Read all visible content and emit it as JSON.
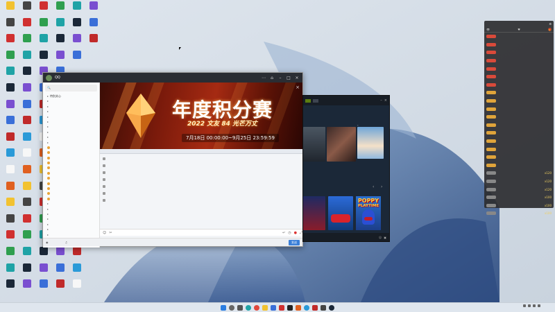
{
  "qq": {
    "title": "QQ",
    "banner": {
      "title": "年度积分赛",
      "subtitle": "2022 文友 84 光芒万丈",
      "dates": "7月18日 00:00:00~9月25日 23:59:59"
    },
    "input_placeholder": "",
    "send_label": "发送",
    "bottom_items": [
      "",
      "",
      "",
      "",
      "",
      "",
      ""
    ],
    "contacts": [
      {
        "label": "特别关心",
        "group": true
      },
      {
        "label": "",
        "group": true
      },
      {
        "label": "",
        "group": true
      },
      {
        "label": "",
        "group": true
      },
      {
        "label": "",
        "group": true
      },
      {
        "label": "",
        "group": true
      },
      {
        "label": "",
        "group": true
      },
      {
        "label": "",
        "group": true
      },
      {
        "label": "",
        "group": true
      },
      {
        "label": "",
        "group": true
      },
      {
        "label": "",
        "group": false
      },
      {
        "label": "",
        "group": false
      },
      {
        "label": "",
        "group": false
      },
      {
        "label": "",
        "group": false
      },
      {
        "label": "",
        "group": false
      },
      {
        "label": "",
        "group": false
      },
      {
        "label": "",
        "group": false
      },
      {
        "label": "",
        "group": false
      },
      {
        "label": "",
        "group": false
      },
      {
        "label": "",
        "group": false
      },
      {
        "label": "",
        "group": false
      },
      {
        "label": "",
        "group": true
      },
      {
        "label": "",
        "group": true
      },
      {
        "label": "",
        "group": true
      },
      {
        "label": "",
        "group": true
      },
      {
        "label": "",
        "group": true
      },
      {
        "label": "",
        "group": true
      },
      {
        "label": "",
        "group": true
      }
    ],
    "messages": [
      "",
      "",
      "",
      "",
      "",
      "",
      ""
    ]
  },
  "steam": {
    "poppy_line1": "POPPY",
    "poppy_line2": "PLAYTIME"
  },
  "chat": {
    "title": "",
    "rows": [
      {
        "badge": "red",
        "amount": ""
      },
      {
        "badge": "red",
        "amount": ""
      },
      {
        "badge": "red",
        "amount": ""
      },
      {
        "badge": "red",
        "amount": ""
      },
      {
        "badge": "red",
        "amount": ""
      },
      {
        "badge": "red",
        "amount": ""
      },
      {
        "badge": "red",
        "amount": ""
      },
      {
        "badge": "gold",
        "amount": ""
      },
      {
        "badge": "gold",
        "amount": ""
      },
      {
        "badge": "gold",
        "amount": ""
      },
      {
        "badge": "gold",
        "amount": ""
      },
      {
        "badge": "gold",
        "amount": ""
      },
      {
        "badge": "gold",
        "amount": ""
      },
      {
        "badge": "gold",
        "amount": ""
      },
      {
        "badge": "gold",
        "amount": ""
      },
      {
        "badge": "gold",
        "amount": ""
      },
      {
        "badge": "gold",
        "amount": ""
      },
      {
        "badge": "gray",
        "amount": "x120"
      },
      {
        "badge": "gray",
        "amount": "x120"
      },
      {
        "badge": "gray",
        "amount": "x120"
      },
      {
        "badge": "gray",
        "amount": "x100"
      },
      {
        "badge": "gray",
        "amount": "x100"
      },
      {
        "badge": "gray",
        "amount": "x100"
      }
    ]
  },
  "taskbar": {
    "clock_time": "",
    "clock_date": ""
  },
  "colors": {
    "qq_titlebar": "#2a2d33",
    "banner_red": "#a52a12",
    "steam_bg": "#1b2838",
    "chat_bg": "#2d2d30",
    "taskbar": "#dfe6ee"
  }
}
